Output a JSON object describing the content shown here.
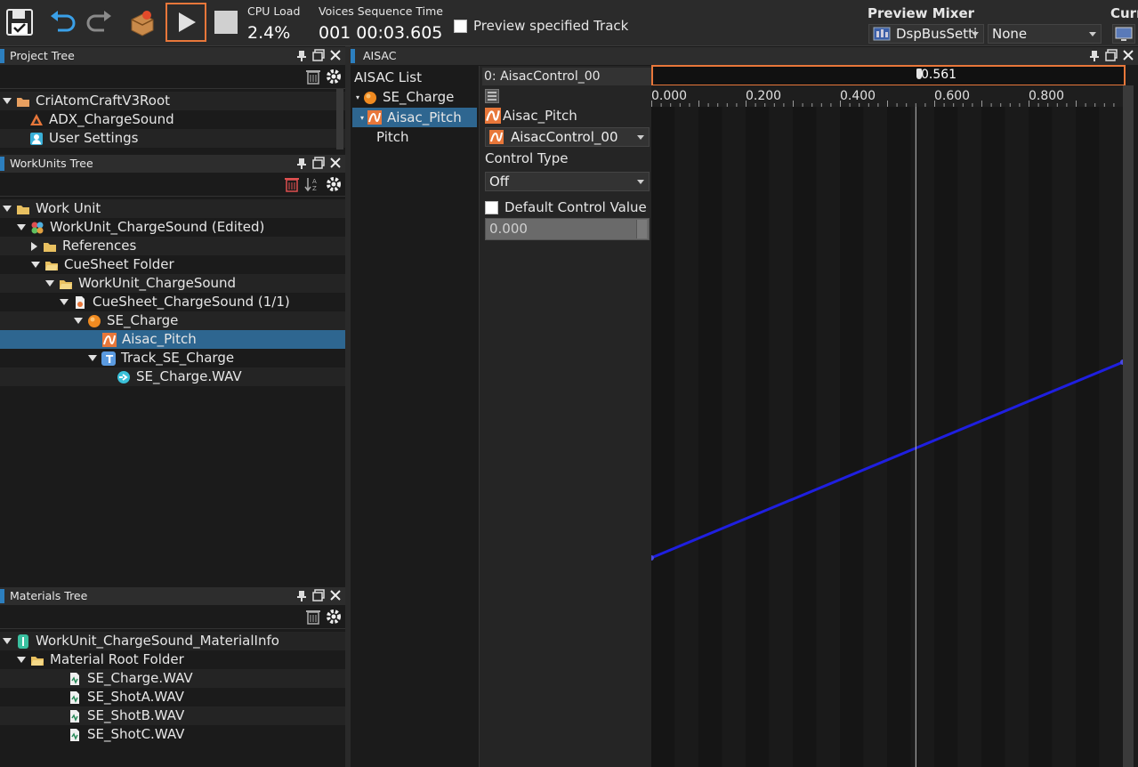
{
  "toolbar": {
    "cpu_label": "CPU Load",
    "cpu_value": "2.4%",
    "voices_label": "Voices Sequence Time",
    "voices_value": "001 00:03.605",
    "preview_track_label": "Preview specified Track",
    "preview_mixer_label": "Preview Mixer",
    "mixer_bus_value": "DspBusSetti",
    "mixer_none_value": "None",
    "cut_label": "Curr"
  },
  "project_tree": {
    "title": "Project Tree",
    "items": [
      {
        "label": "CriAtomCraftV3Root"
      },
      {
        "label": "ADX_ChargeSound"
      },
      {
        "label": "User Settings"
      }
    ]
  },
  "workunits_tree": {
    "title": "WorkUnits Tree",
    "items": [
      {
        "label": "Work Unit"
      },
      {
        "label": "WorkUnit_ChargeSound (Edited)"
      },
      {
        "label": "References"
      },
      {
        "label": "CueSheet Folder"
      },
      {
        "label": "WorkUnit_ChargeSound"
      },
      {
        "label": "CueSheet_ChargeSound (1/1)"
      },
      {
        "label": "SE_Charge"
      },
      {
        "label": "Aisac_Pitch"
      },
      {
        "label": "Track_SE_Charge"
      },
      {
        "label": "SE_Charge.WAV"
      }
    ]
  },
  "materials_tree": {
    "title": "Materials Tree",
    "items": [
      {
        "label": "WorkUnit_ChargeSound_MaterialInfo"
      },
      {
        "label": "Material Root Folder"
      },
      {
        "label": "SE_Charge.WAV"
      },
      {
        "label": "SE_ShotA.WAV"
      },
      {
        "label": "SE_ShotB.WAV"
      },
      {
        "label": "SE_ShotC.WAV"
      }
    ]
  },
  "aisac": {
    "title": "AISAC",
    "list_title": "AISAC List",
    "list_items": [
      {
        "label": "SE_Charge"
      },
      {
        "label": "Aisac_Pitch"
      },
      {
        "label": "Pitch"
      }
    ],
    "control_header": "0: AisacControl_00",
    "aisac_name": "Aisac_Pitch",
    "control_select": "AisacControl_00",
    "control_type_label": "Control Type",
    "control_type_value": "Off",
    "default_value_label": "Default Control Value",
    "default_value": "0.000",
    "cursor_value": "0.561",
    "ruler_ticks": [
      "0.000",
      "0.200",
      "0.400",
      "0.600",
      "0.800"
    ]
  },
  "chart_data": {
    "type": "line",
    "x": [
      0.0,
      1.0
    ],
    "series": [
      {
        "values": [
          0.0,
          1.0
        ]
      }
    ],
    "cursor_x": 0.561,
    "line_color": "#1f1fe0"
  },
  "colors": {
    "accent": "#e8773a",
    "selection": "#2e6690",
    "panel_marker": "#2c7fbf"
  }
}
